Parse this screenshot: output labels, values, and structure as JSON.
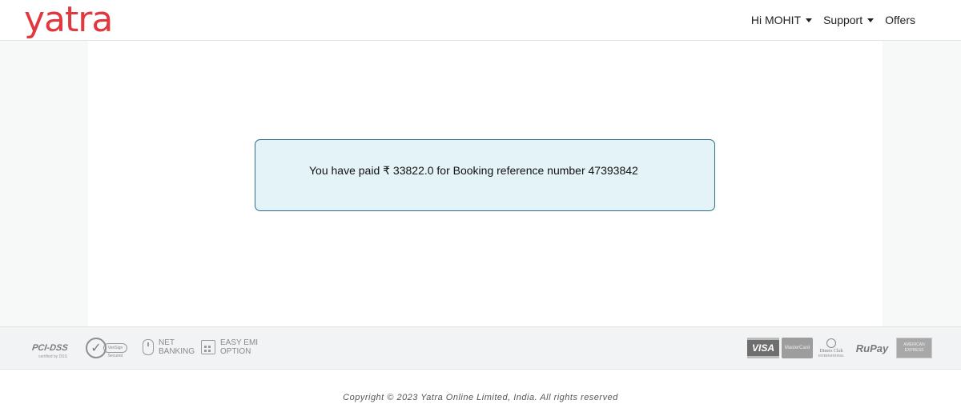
{
  "header": {
    "logo_text": "yatra",
    "nav": {
      "user_label": "Hi MOHIT",
      "support_label": "Support",
      "offers_label": "Offers"
    }
  },
  "main": {
    "message": "You have paid ₹ 33822.0 for Booking reference number 47393842"
  },
  "trust_badges": {
    "pci": "PCI-DSS",
    "pci_sub": "certified by DSS",
    "verisign_sub": "VeriSign Secured",
    "net_banking": [
      "NET",
      "BANKING"
    ],
    "easy_emi": [
      "EASY EMI",
      "OPTION"
    ]
  },
  "payment_logos": {
    "visa": "VISA",
    "mastercard": "MasterCard",
    "diners": [
      "Diners Club",
      "INTERNATIONAL"
    ],
    "rupay": "RuPay",
    "amex": [
      "AMERICAN",
      "EXPRESS"
    ]
  },
  "footer": {
    "copyright": "Copyright © 2023 Yatra Online Limited, India. All rights reserved"
  },
  "colors": {
    "brand": "#e0383e",
    "message_bg": "#e4f3f8",
    "message_border": "#2f6f86"
  }
}
